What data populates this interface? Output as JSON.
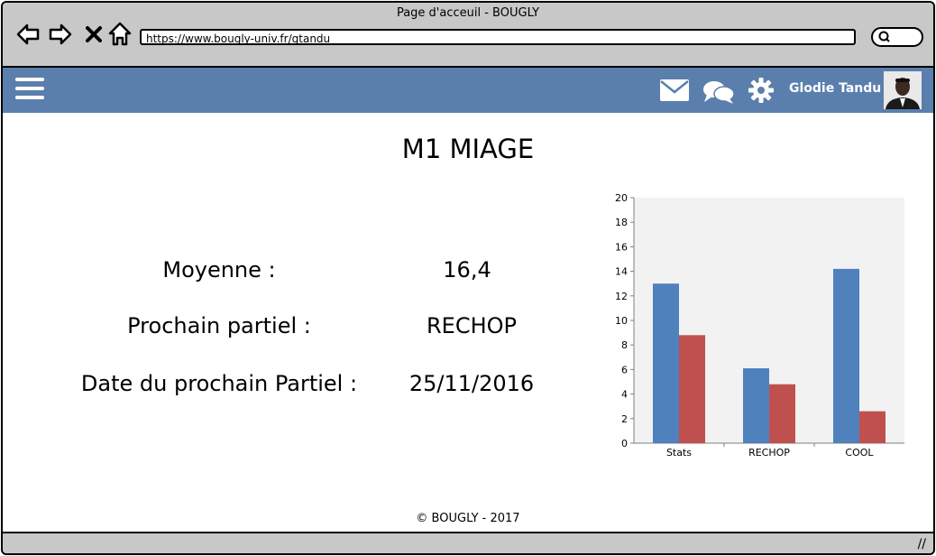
{
  "window": {
    "title": "Page d'acceuil - BOUGLY"
  },
  "browser": {
    "url": "https://www.bougly-univ.fr/gtandu"
  },
  "header": {
    "user_name": "Glodie Tandu",
    "accent": "#5b7fad"
  },
  "main": {
    "title": "M1 MIAGE",
    "rows": [
      {
        "label": "Moyenne :",
        "value": "16,4"
      },
      {
        "label": "Prochain partiel :",
        "value": "RECHOP"
      },
      {
        "label": "Date du prochain Partiel :",
        "value": "25/11/2016"
      }
    ]
  },
  "chart_data": {
    "type": "bar",
    "categories": [
      "Stats",
      "RECHOP",
      "COOL"
    ],
    "series": [
      {
        "values": [
          13,
          6.1,
          14.2
        ],
        "color": "#4f81bd"
      },
      {
        "values": [
          8.8,
          4.8,
          2.6
        ],
        "color": "#c0504d"
      }
    ],
    "ylim": [
      0,
      20
    ],
    "yticks": [
      "0",
      "2",
      "4",
      "6",
      "8",
      "10",
      "12",
      "14",
      "16",
      "18",
      "20"
    ],
    "grid": false,
    "background": "#f2f2f2"
  },
  "footer": {
    "text": "© BOUGLY - 2017"
  }
}
